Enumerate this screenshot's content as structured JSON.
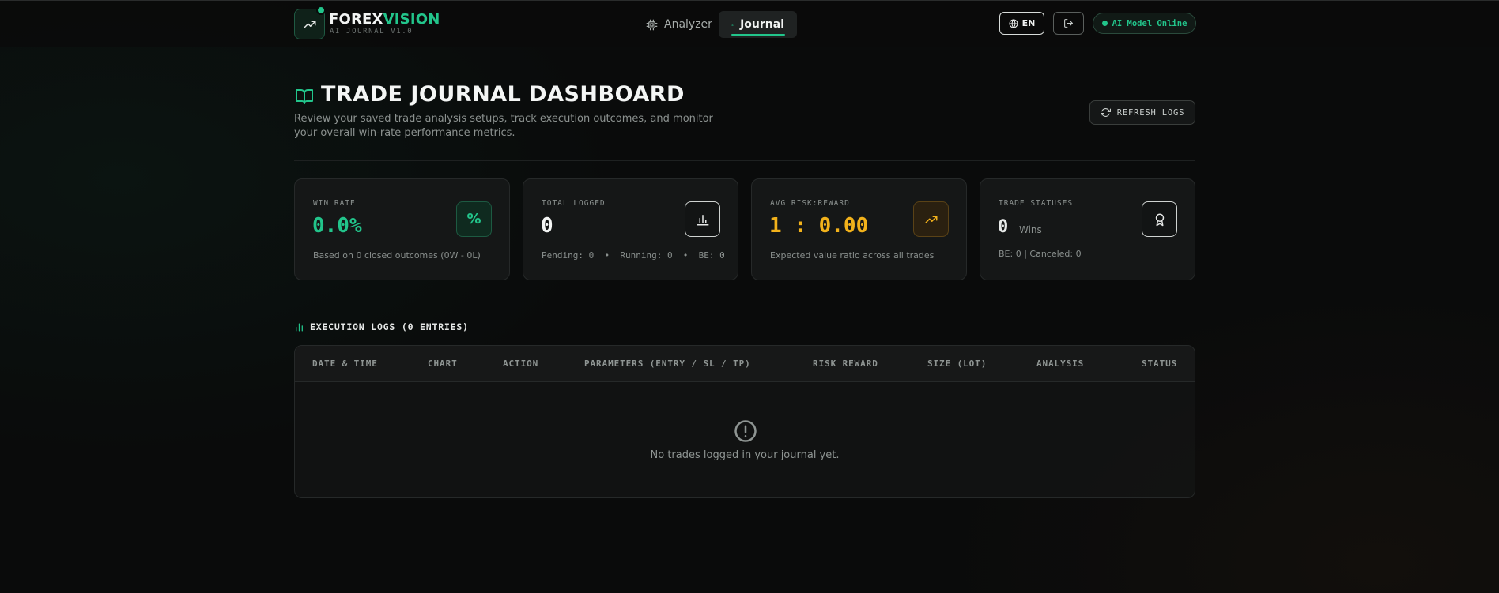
{
  "header": {
    "brand_part1": "FOREX",
    "brand_part2": "VISION",
    "brand_sub": "AI JOURNAL V1.0",
    "nav": [
      {
        "label": "Analyzer"
      },
      {
        "label": "Journal"
      }
    ],
    "lang_label": "EN",
    "status_label": "AI Model Online"
  },
  "page": {
    "title": "TRADE JOURNAL DASHBOARD",
    "description": "Review your saved trade analysis setups, track execution outcomes, and monitor your overall win-rate performance metrics.",
    "refresh_label": "REFRESH LOGS"
  },
  "stats": {
    "win_rate": {
      "label": "WIN RATE",
      "value": "0.0%",
      "note": "Based on 0 closed outcomes (0W - 0L)",
      "icon_text": "%"
    },
    "total_logged": {
      "label": "TOTAL LOGGED",
      "value": "0",
      "note": "Pending: 0  •  Running: 0  •  BE: 0"
    },
    "avg_rr": {
      "label": "AVG RISK:REWARD",
      "value": "1 : 0.00",
      "note": "Expected value ratio across all trades"
    },
    "statuses": {
      "label": "TRADE STATUSES",
      "value": "0",
      "wins_label": "Wins",
      "note": "BE: 0 | Canceled: 0"
    }
  },
  "logs": {
    "title": "EXECUTION LOGS (0 ENTRIES)",
    "columns": [
      "DATE & TIME",
      "CHART",
      "ACTION",
      "PARAMETERS (ENTRY / SL / TP)",
      "RISK REWARD",
      "SIZE (LOT)",
      "ANALYSIS",
      "STATUS"
    ],
    "empty_text": "No trades logged in your journal yet."
  },
  "colors": {
    "accent_green": "#22c58b",
    "accent_amber": "#f2b21b",
    "background": "#0a0b0b"
  }
}
